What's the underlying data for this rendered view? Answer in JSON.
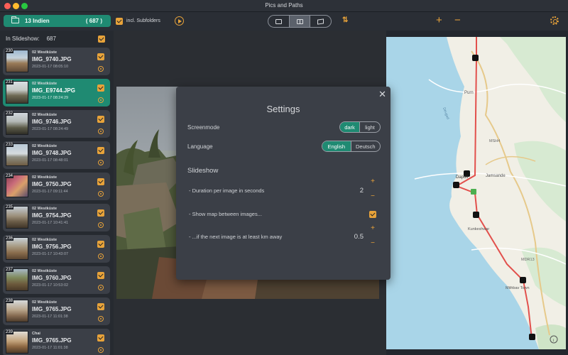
{
  "window": {
    "title": "Pics and Paths"
  },
  "toolbar": {
    "folder_name": "13 Indien",
    "folder_count": "( 687 )",
    "subfolders_label": "incl. Subfolders",
    "view_modes": [
      "image-view",
      "split-view",
      "map-view"
    ],
    "active_view": "split-view"
  },
  "sidebar": {
    "header_label": "In Slideshow:",
    "header_count": "687",
    "items": [
      {
        "num": "230",
        "folder": "02 Westküste",
        "name": "IMG_9740.JPG",
        "date": "2023-01-17 08:05:10",
        "selected": false
      },
      {
        "num": "231",
        "folder": "02 Westküste",
        "name": "IMG_E9744.JPG",
        "date": "2023-01-17 08:24:29",
        "selected": true
      },
      {
        "num": "232",
        "folder": "02 Westküste",
        "name": "IMG_9746.JPG",
        "date": "2023-01-17 08:24:49",
        "selected": false
      },
      {
        "num": "233",
        "folder": "02 Westküste",
        "name": "IMG_9748.JPG",
        "date": "2023-01-17 08:48:01",
        "selected": false
      },
      {
        "num": "234",
        "folder": "02 Westküste",
        "name": "IMG_9750.JPG",
        "date": "2023-01-17 09:11:44",
        "selected": false
      },
      {
        "num": "235",
        "folder": "02 Westküste",
        "name": "IMG_9754.JPG",
        "date": "2023-01-17 10:41:41",
        "selected": false
      },
      {
        "num": "236",
        "folder": "02 Westküste",
        "name": "IMG_9756.JPG",
        "date": "2023-01-17 10:43:07",
        "selected": false
      },
      {
        "num": "237",
        "folder": "02 Westküste",
        "name": "IMG_9760.JPG",
        "date": "2023-01-17 10:53:02",
        "selected": false
      },
      {
        "num": "238",
        "folder": "02 Westküste",
        "name": "IMG_9765.JPG",
        "date": "2023-01-17 11:01:38",
        "selected": false
      },
      {
        "num": "239",
        "folder": "Chai",
        "name": "IMG_9765.JPG",
        "date": "2023-01-17 11:01:38",
        "selected": false
      }
    ]
  },
  "settings": {
    "title": "Settings",
    "screenmode_label": "Screenmode",
    "screenmode_options": [
      "dark",
      "light"
    ],
    "screenmode_selected": "dark",
    "language_label": "Language",
    "language_options": [
      "English",
      "Deutsch"
    ],
    "language_selected": "English",
    "section_title": "Slideshow",
    "duration_label": "- Duration per image in seconds",
    "duration_value": "2",
    "showmap_label": "- Show map between images...",
    "showmap_checked": true,
    "distance_label": "- ...if the next image is at least km away",
    "distance_value": "0.5"
  },
  "map": {
    "labels": [
      "Dapoli",
      "Jamsande",
      "Kunkeshwar",
      "Mithbav Town",
      "MSH4",
      "MDR13",
      "Purn",
      "Devgad"
    ]
  },
  "colors": {
    "accent": "#e8a33a",
    "selection": "#1f8a72",
    "route": "#e2504c"
  }
}
